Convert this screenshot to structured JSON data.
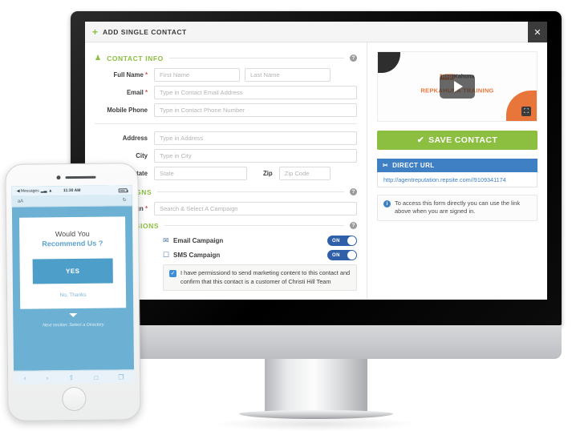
{
  "modal": {
    "plus_icon": "+",
    "title": "ADD SINGLE CONTACT",
    "close_icon": "✕"
  },
  "sections": {
    "contact_info": {
      "icon": "♟",
      "title": "CONTACT INFO",
      "help": "?"
    },
    "campaigns": {
      "icon": "✉",
      "title": "CAMPAIGNS",
      "help": "?"
    },
    "permissions": {
      "icon": "✔",
      "title": "PERMISSIONS",
      "help": "?"
    }
  },
  "form": {
    "full_name_label": "Full Name",
    "first_name_placeholder": "First Name",
    "last_name_placeholder": "Last Name",
    "email_label": "Email",
    "email_placeholder": "Type in Contact Email Address",
    "mobile_label": "Mobile Phone",
    "mobile_placeholder": "Type in Contact Phone Number",
    "address_label": "Address",
    "address_placeholder": "Type in Address",
    "city_label": "City",
    "city_placeholder": "Type in City",
    "state_label": "State",
    "state_placeholder": "State",
    "zip_label": "Zip",
    "zip_placeholder": "Zip Code",
    "campaign_label": "Campaign",
    "campaign_placeholder": "Search & Select A Campaign",
    "required_marker": "*"
  },
  "permissions": {
    "email_campaign_label": "Email Campaign",
    "email_campaign_state": "ON",
    "email_icon": "✉",
    "sms_campaign_label": "SMS Campaign",
    "sms_campaign_state": "ON",
    "sms_icon": "☐",
    "consent_checked": "✓",
    "consent_text": "I have permissiond to send marketing content to this contact and confirm that this contact is a customer of Christi Hill Team"
  },
  "right_panel": {
    "video_logo_a": "Rep",
    "video_logo_b": "Kahuna",
    "video_subtitle": "REPKAHUNA TRAINING",
    "play_icon": "play-icon",
    "fullscreen_icon": "⛶",
    "save_check": "✔",
    "save_label": "SAVE CONTACT",
    "url_head_icon": "✂",
    "url_head_label": "DIRECT URL",
    "url_value": "http://agentreputation.repsite.com//9109341174",
    "note_icon": "i",
    "note_text": "To access this form directly you can use the link above when you are signed in."
  },
  "phone": {
    "status_back": "◀ Messages",
    "status_signal": "▂▃",
    "status_wifi": "▲",
    "status_time": "11:30 AM",
    "urlbar_aa": "aA",
    "urlbar_reload": "↻",
    "question_line1": "Would You",
    "question_line2": "Recommend Us ?",
    "yes_label": "YES",
    "no_label": "No, Thanks",
    "next_section": "Next section: Select a Directory",
    "toolbar": [
      "‹",
      "›",
      "⇧",
      "□",
      "❐"
    ]
  },
  "colors": {
    "green": "#8cbf3f",
    "blue": "#3f7fc4",
    "toggle_blue": "#2f5fa8",
    "orange": "#e8763a",
    "phone_blue": "#6cb0d4"
  }
}
